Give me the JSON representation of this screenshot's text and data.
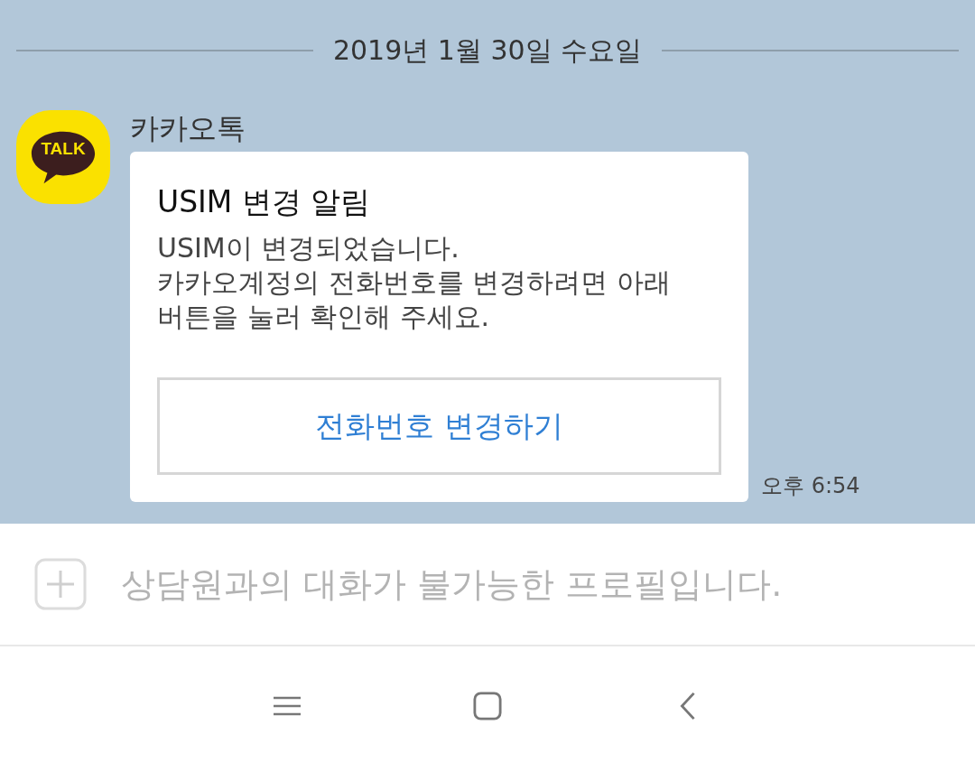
{
  "date_divider": "2019년 1월 30일 수요일",
  "message": {
    "sender": "카카오톡",
    "avatar_text": "TALK",
    "card": {
      "title": "USIM 변경 알림",
      "body_lines": [
        "USIM이 변경되었습니다.",
        "카카오계정의 전화번호를 변경하려면 아래",
        "버튼을 눌러 확인해 주세요."
      ],
      "button": "전화번호 변경하기"
    },
    "time": "오후 6:54"
  },
  "input_bar": {
    "notice": "상담원과의 대화가 불가능한 프로필입니다."
  }
}
